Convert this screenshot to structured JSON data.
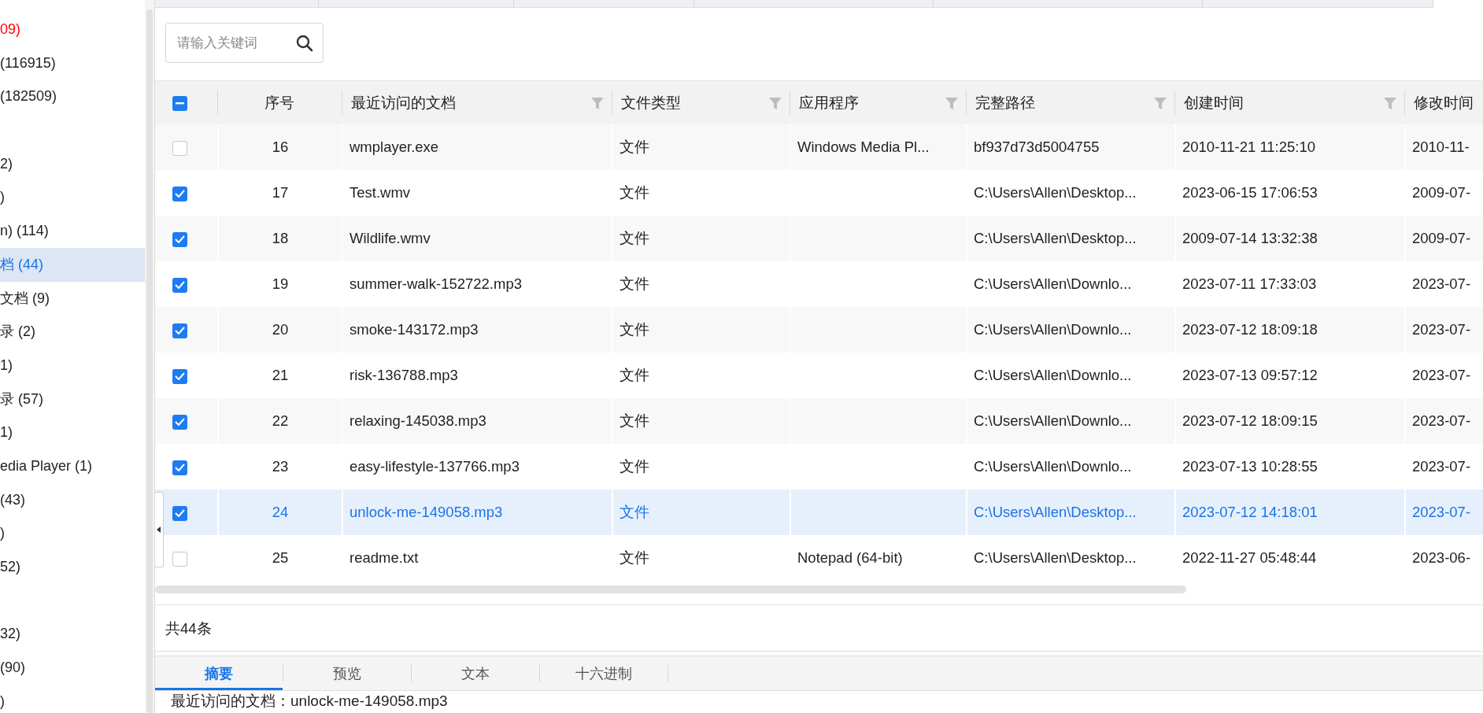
{
  "sidebar": {
    "items": [
      {
        "label": "09)",
        "color": "#ff0000",
        "selected": false
      },
      {
        "label": "(116915)",
        "color": "#222222",
        "selected": false
      },
      {
        "label": "(182509)",
        "color": "#222222",
        "selected": false
      },
      {
        "label": "2)",
        "color": "#222222",
        "selected": false,
        "gap_before": true
      },
      {
        "label": ")",
        "color": "#222222",
        "selected": false
      },
      {
        "label": "n) (114)",
        "color": "#222222",
        "selected": false
      },
      {
        "label": "档 (44)",
        "color": "#1a73e8",
        "selected": true
      },
      {
        "label": "文档 (9)",
        "color": "#222222",
        "selected": false
      },
      {
        "label": "录 (2)",
        "color": "#222222",
        "selected": false
      },
      {
        "label": "1)",
        "color": "#222222",
        "selected": false
      },
      {
        "label": "录 (57)",
        "color": "#222222",
        "selected": false
      },
      {
        "label": "1)",
        "color": "#222222",
        "selected": false
      },
      {
        "label": "edia Player (1)",
        "color": "#222222",
        "selected": false
      },
      {
        "label": "(43)",
        "color": "#222222",
        "selected": false
      },
      {
        "label": ")",
        "color": "#222222",
        "selected": false
      },
      {
        "label": "52)",
        "color": "#222222",
        "selected": false
      },
      {
        "label": "32)",
        "color": "#222222",
        "selected": false,
        "gap_before": true
      },
      {
        "label": "(90)",
        "color": "#222222",
        "selected": false
      },
      {
        "label": ")",
        "color": "#222222",
        "selected": false
      }
    ]
  },
  "search": {
    "placeholder": "请输入关键词"
  },
  "table": {
    "select_all_partial": true,
    "columns": [
      {
        "label": "序号",
        "filter": false
      },
      {
        "label": "最近访问的文档",
        "filter": true
      },
      {
        "label": "文件类型",
        "filter": true
      },
      {
        "label": "应用程序",
        "filter": true
      },
      {
        "label": "完整路径",
        "filter": true
      },
      {
        "label": "创建时间",
        "filter": true
      },
      {
        "label": "修改时间",
        "filter": false
      }
    ],
    "rows": [
      {
        "no": "16",
        "name": "wmplayer.exe",
        "type": "文件",
        "app": "Windows Media Pl...",
        "path": "bf937d73d5004755",
        "created": "2010-11-21 11:25:10",
        "modified": "2010-11-",
        "checked": false,
        "selected": false
      },
      {
        "no": "17",
        "name": "Test.wmv",
        "type": "文件",
        "path": "C:\\Users\\Allen\\Desktop...",
        "created": "2023-06-15 17:06:53",
        "modified": "2009-07-",
        "checked": true,
        "selected": false
      },
      {
        "no": "18",
        "name": "Wildlife.wmv",
        "type": "文件",
        "path": "C:\\Users\\Allen\\Desktop...",
        "created": "2009-07-14 13:32:38",
        "modified": "2009-07-",
        "checked": true,
        "selected": false
      },
      {
        "no": "19",
        "name": "summer-walk-152722.mp3",
        "type": "文件",
        "path": "C:\\Users\\Allen\\Downlo...",
        "created": "2023-07-11 17:33:03",
        "modified": "2023-07-",
        "checked": true,
        "selected": false
      },
      {
        "no": "20",
        "name": "smoke-143172.mp3",
        "type": "文件",
        "path": "C:\\Users\\Allen\\Downlo...",
        "created": "2023-07-12 18:09:18",
        "modified": "2023-07-",
        "checked": true,
        "selected": false
      },
      {
        "no": "21",
        "name": "risk-136788.mp3",
        "type": "文件",
        "path": "C:\\Users\\Allen\\Downlo...",
        "created": "2023-07-13 09:57:12",
        "modified": "2023-07-",
        "checked": true,
        "selected": false
      },
      {
        "no": "22",
        "name": "relaxing-145038.mp3",
        "type": "文件",
        "path": "C:\\Users\\Allen\\Downlo...",
        "created": "2023-07-12 18:09:15",
        "modified": "2023-07-",
        "checked": true,
        "selected": false
      },
      {
        "no": "23",
        "name": "easy-lifestyle-137766.mp3",
        "type": "文件",
        "path": "C:\\Users\\Allen\\Downlo...",
        "created": "2023-07-13 10:28:55",
        "modified": "2023-07-",
        "checked": true,
        "selected": false
      },
      {
        "no": "24",
        "name": "unlock-me-149058.mp3",
        "type": "文件",
        "path": "C:\\Users\\Allen\\Desktop...",
        "created": "2023-07-12 14:18:01",
        "modified": "2023-07-",
        "checked": true,
        "selected": true
      },
      {
        "no": "25",
        "name": "readme.txt",
        "type": "文件",
        "app": "Notepad (64-bit)",
        "path": "C:\\Users\\Allen\\Desktop...",
        "created": "2022-11-27 05:48:44",
        "modified": "2023-06-",
        "checked": false,
        "selected": false
      }
    ]
  },
  "total": "共44条",
  "detail_tabs": [
    {
      "label": "摘要",
      "selected": true
    },
    {
      "label": "预览",
      "selected": false
    },
    {
      "label": "文本",
      "selected": false
    },
    {
      "label": "十六进制",
      "selected": false
    }
  ],
  "detail_text": "最近访问的文档：unlock-me-149058.mp3"
}
